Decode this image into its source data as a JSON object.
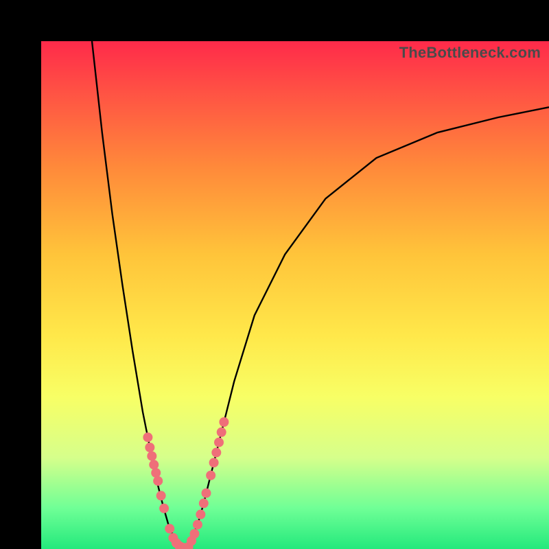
{
  "watermark": "TheBottleneck.com",
  "colors": {
    "frame": "#000000",
    "curve": "#000000",
    "dot": "#ef6f79",
    "gradient_top": "#ff2a4a",
    "gradient_bottom": "#23e97c"
  },
  "chart_data": {
    "type": "line",
    "title": "",
    "xlabel": "",
    "ylabel": "",
    "xlim": [
      0,
      100
    ],
    "ylim": [
      0,
      100
    ],
    "series": [
      {
        "name": "bottleneck-curve-left",
        "x": [
          10,
          12,
          14,
          16,
          18,
          20,
          21,
          22,
          23,
          24,
          25,
          26,
          27,
          28
        ],
        "values": [
          100,
          82,
          66,
          52,
          39,
          27,
          22,
          17,
          12.5,
          8.5,
          5,
          2.5,
          1,
          0.2
        ]
      },
      {
        "name": "bottleneck-curve-right",
        "x": [
          28,
          29,
          30,
          31,
          32,
          33,
          34,
          36,
          38,
          42,
          48,
          56,
          66,
          78,
          90,
          100
        ],
        "values": [
          0.2,
          1,
          2.8,
          5.5,
          9,
          13,
          17,
          25,
          33,
          46,
          58,
          69,
          77,
          82,
          85,
          87
        ]
      }
    ],
    "scatter": [
      {
        "name": "markers-left",
        "points": [
          {
            "x": 21.0,
            "y": 22.0
          },
          {
            "x": 21.4,
            "y": 20.0
          },
          {
            "x": 21.8,
            "y": 18.3
          },
          {
            "x": 22.2,
            "y": 16.6
          },
          {
            "x": 22.6,
            "y": 15.0
          },
          {
            "x": 23.0,
            "y": 13.4
          },
          {
            "x": 23.6,
            "y": 10.5
          },
          {
            "x": 24.2,
            "y": 8.0
          },
          {
            "x": 25.3,
            "y": 4.0
          },
          {
            "x": 26.0,
            "y": 2.2
          },
          {
            "x": 26.6,
            "y": 1.2
          },
          {
            "x": 27.2,
            "y": 0.6
          },
          {
            "x": 27.8,
            "y": 0.3
          },
          {
            "x": 28.4,
            "y": 0.2
          },
          {
            "x": 29.0,
            "y": 0.4
          }
        ]
      },
      {
        "name": "markers-right",
        "points": [
          {
            "x": 29.6,
            "y": 1.6
          },
          {
            "x": 30.2,
            "y": 3.0
          },
          {
            "x": 30.8,
            "y": 4.8
          },
          {
            "x": 31.4,
            "y": 6.8
          },
          {
            "x": 32.0,
            "y": 9.0
          },
          {
            "x": 32.5,
            "y": 11.0
          },
          {
            "x": 33.4,
            "y": 14.5
          },
          {
            "x": 34.0,
            "y": 17.0
          },
          {
            "x": 34.5,
            "y": 19.0
          },
          {
            "x": 35.0,
            "y": 21.0
          },
          {
            "x": 35.5,
            "y": 23.0
          },
          {
            "x": 36.0,
            "y": 25.0
          }
        ]
      }
    ]
  }
}
